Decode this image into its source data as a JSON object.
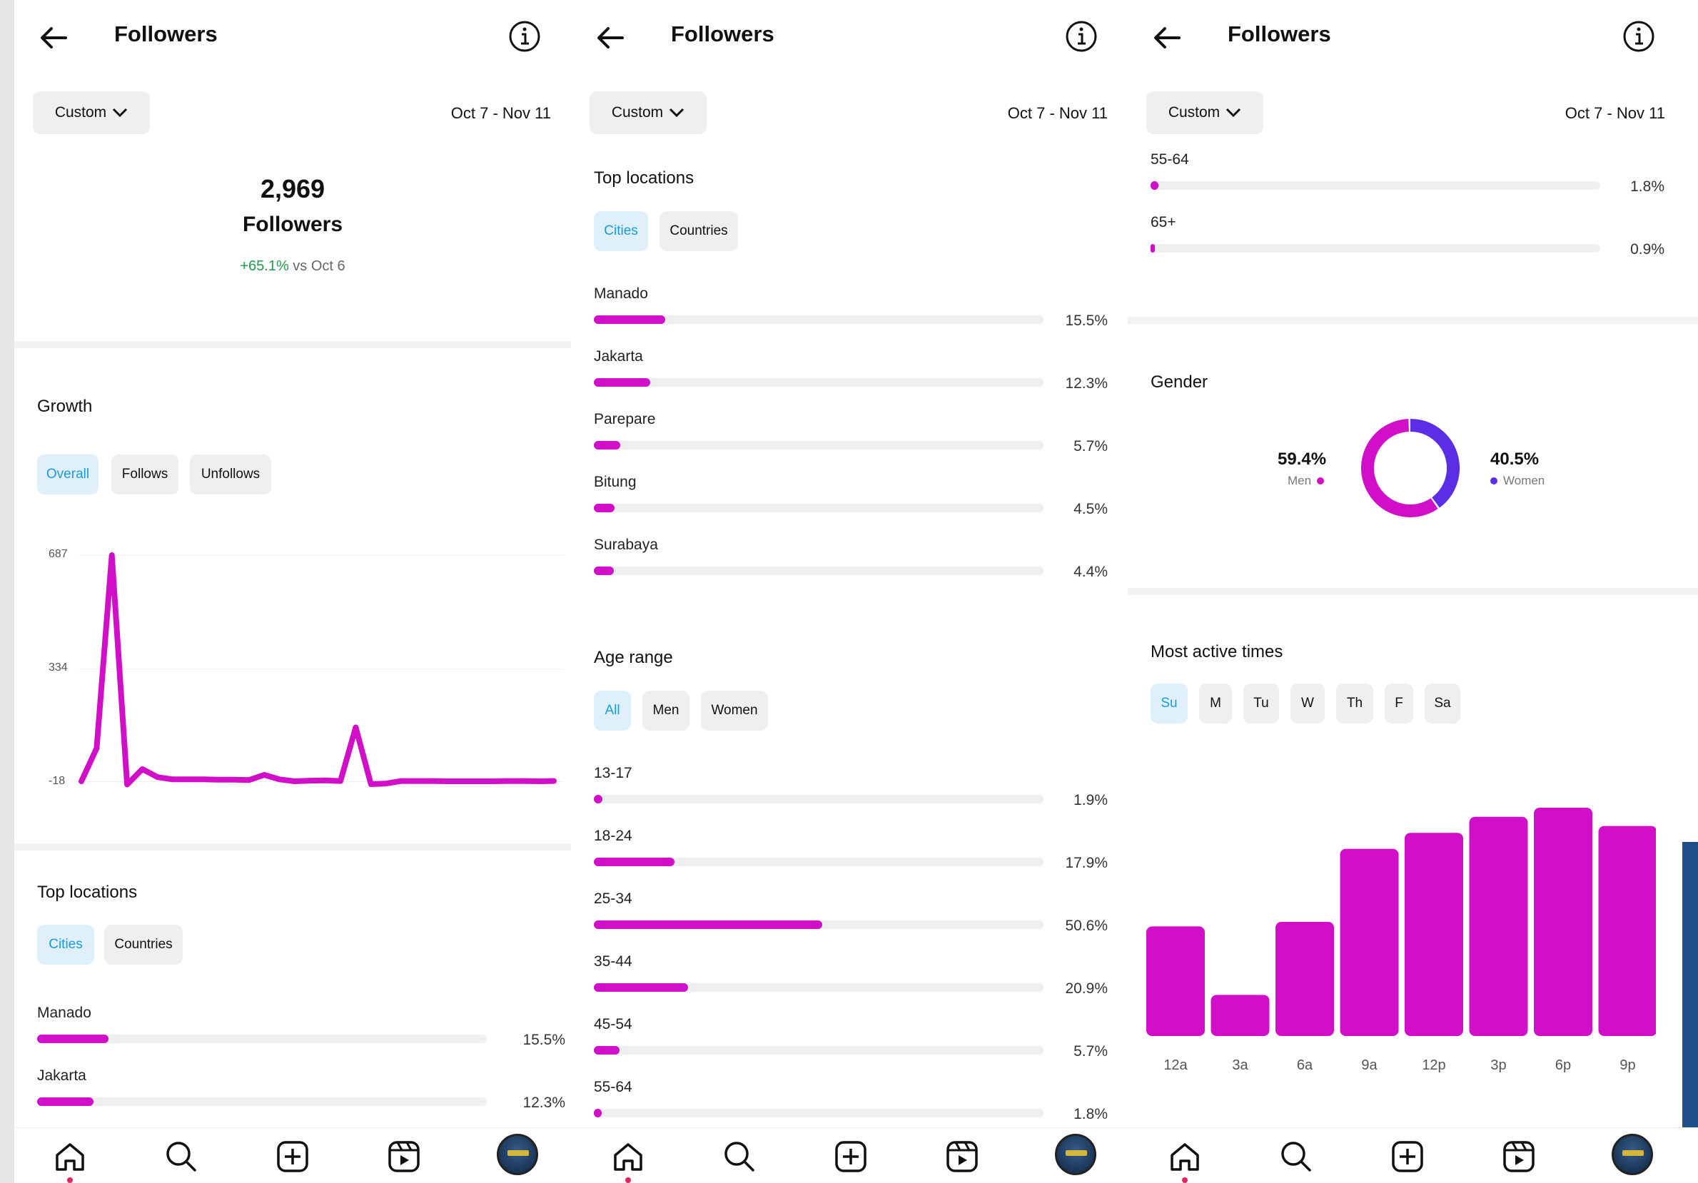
{
  "header": {
    "title": "Followers",
    "filter_label": "Custom",
    "date_range": "Oct 7 - Nov 11"
  },
  "overview": {
    "count": "2,969",
    "label": "Followers",
    "change": "+65.1%",
    "change_suffix": "vs Oct 6"
  },
  "growth": {
    "title": "Growth",
    "tabs": [
      "Overall",
      "Follows",
      "Unfollows"
    ],
    "y_ticks": [
      "687",
      "334",
      "-18"
    ]
  },
  "chart_data": {
    "type": "line",
    "title": "",
    "xlabel": "",
    "ylabel": "",
    "ylim": [
      -18,
      687
    ],
    "series": [
      {
        "values": [
          -18,
          85,
          687,
          -28,
          20,
          -5,
          -12,
          -12,
          -12,
          -13,
          -13,
          -14,
          2,
          -12,
          -18,
          -16,
          -15,
          -17,
          150,
          -27,
          -25,
          -17,
          -17,
          -17,
          -18,
          -18,
          -18,
          -18,
          -17,
          -17,
          -18,
          -17
        ]
      }
    ]
  },
  "locations": {
    "title": "Top locations",
    "tabs": [
      "Cities",
      "Countries"
    ],
    "items": [
      {
        "name": "Manado",
        "pct": "15.5%",
        "value": 15.5
      },
      {
        "name": "Jakarta",
        "pct": "12.3%",
        "value": 12.3
      },
      {
        "name": "Parepare",
        "pct": "5.7%",
        "value": 5.7
      },
      {
        "name": "Bitung",
        "pct": "4.5%",
        "value": 4.5
      },
      {
        "name": "Surabaya",
        "pct": "4.4%",
        "value": 4.4
      }
    ]
  },
  "age": {
    "title": "Age range",
    "tabs": [
      "All",
      "Men",
      "Women"
    ],
    "items": [
      {
        "name": "13-17",
        "pct": "1.9%",
        "value": 1.9
      },
      {
        "name": "18-24",
        "pct": "17.9%",
        "value": 17.9
      },
      {
        "name": "25-34",
        "pct": "50.6%",
        "value": 50.6
      },
      {
        "name": "35-44",
        "pct": "20.9%",
        "value": 20.9
      },
      {
        "name": "45-54",
        "pct": "5.7%",
        "value": 5.7
      },
      {
        "name": "55-64",
        "pct": "1.8%",
        "value": 1.8
      },
      {
        "name": "65+",
        "pct": "0.9%",
        "value": 0.9
      }
    ]
  },
  "gender": {
    "title": "Gender",
    "men_pct": "59.4%",
    "men_label": "Men",
    "women_pct": "40.5%",
    "women_label": "Women",
    "men_value": 59.4,
    "women_value": 40.5,
    "men_color": "#d10fc8",
    "women_color": "#5b2ee6"
  },
  "active": {
    "title": "Most active times",
    "days": [
      "Su",
      "M",
      "Tu",
      "W",
      "Th",
      "F",
      "Sa"
    ],
    "times": [
      "12a",
      "3a",
      "6a",
      "9a",
      "12p",
      "3p",
      "6p",
      "9p"
    ],
    "values": [
      48,
      18,
      50,
      82,
      89,
      96,
      100,
      92
    ]
  },
  "colors": {
    "accent": "#d10fc8",
    "active_tab": "#1a9be0"
  },
  "nav_icons": [
    "home-icon",
    "search-icon",
    "create-icon",
    "reels-icon",
    "profile-avatar"
  ]
}
